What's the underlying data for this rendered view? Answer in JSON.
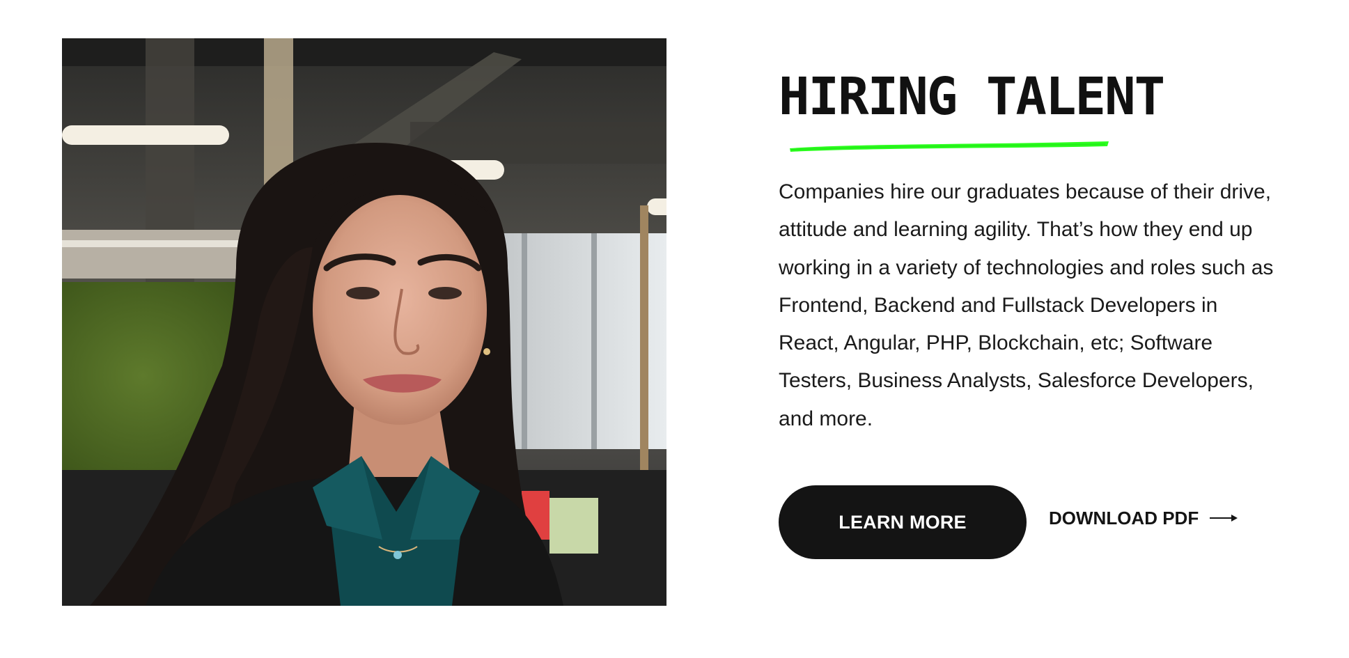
{
  "section": {
    "title": "HIRING TALENT",
    "description": "Companies hire our graduates because of their drive, attitude and learning agility. That’s how they end up working in a variety of technologies and roles such as Frontend, Backend and Fullstack Developers in React, Angular, PHP, Blockchain, etc; Software Testers, Business Analysts, Salesforce Developers, and more."
  },
  "actions": {
    "learn_more_label": "LEARN MORE",
    "download_label": "DOWNLOAD PDF"
  },
  "icons": {
    "underline": "green-brush-stroke",
    "download_arrow": "arrow-right-icon"
  },
  "colors": {
    "accent": "#2bff1e",
    "button_bg": "#141414",
    "text": "#141414"
  },
  "image": {
    "alt": "Smiling woman with long dark hair in an office"
  }
}
